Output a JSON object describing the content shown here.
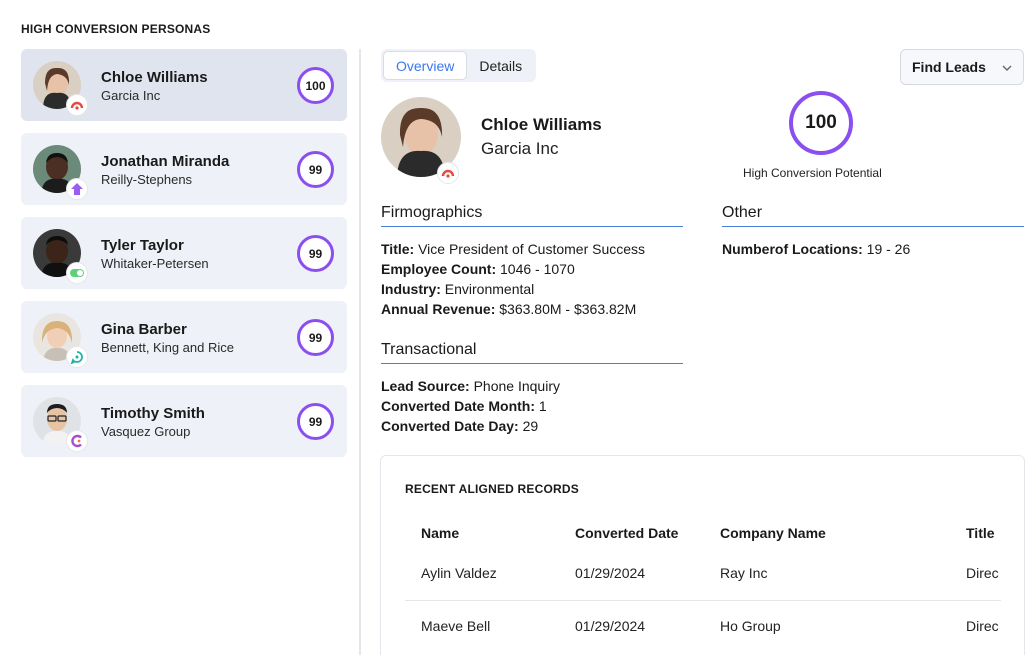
{
  "header": {
    "section_title": "HIGH CONVERSION PERSONAS"
  },
  "personas": [
    {
      "name": "Chloe Williams",
      "company": "Garcia Inc",
      "score": "100",
      "badge_icon": "crm-arc-icon",
      "selected": true
    },
    {
      "name": "Jonathan Miranda",
      "company": "Reilly-Stephens",
      "score": "99",
      "badge_icon": "purple-house-icon"
    },
    {
      "name": "Tyler Taylor",
      "company": "Whitaker-Petersen",
      "score": "99",
      "badge_icon": "green-toggle-icon"
    },
    {
      "name": "Gina Barber",
      "company": "Bennett, King and Rice",
      "score": "99",
      "badge_icon": "teal-chat-icon"
    },
    {
      "name": "Timothy Smith",
      "company": "Vasquez Group",
      "score": "99",
      "badge_icon": "purple-c-icon"
    }
  ],
  "tabs": [
    {
      "label": "Overview",
      "active": true
    },
    {
      "label": "Details"
    }
  ],
  "find_leads": {
    "label": "Find Leads"
  },
  "detail": {
    "name": "Chloe Williams",
    "company": "Garcia Inc",
    "score": "100",
    "score_label": "High Conversion Potential",
    "firmographics": {
      "heading": "Firmographics",
      "fields": [
        {
          "label": "Title:",
          "value": "Vice President of Customer Success"
        },
        {
          "label": "Employee Count:",
          "value": "1046 - 1070"
        },
        {
          "label": "Industry:",
          "value": "Environmental"
        },
        {
          "label": "Annual Revenue:",
          "value": "$363.80M - $363.82M"
        }
      ]
    },
    "other": {
      "heading": "Other",
      "fields": [
        {
          "label": "Numberof Locations:",
          "value": "19 - 26"
        }
      ]
    },
    "transactional": {
      "heading": "Transactional",
      "fields": [
        {
          "label": "Lead Source:",
          "value": "Phone Inquiry"
        },
        {
          "label": "Converted Date Month:",
          "value": "1"
        },
        {
          "label": "Converted Date Day:",
          "value": "29"
        }
      ]
    }
  },
  "records": {
    "title": "RECENT ALIGNED RECORDS",
    "columns": [
      "Name",
      "Converted Date",
      "Company Name",
      "Title"
    ],
    "rows": [
      [
        "Aylin Valdez",
        "01/29/2024",
        "Ray Inc",
        "Direc"
      ],
      [
        "Maeve Bell",
        "01/29/2024",
        "Ho Group",
        "Direc"
      ]
    ]
  },
  "colors": {
    "accent_purple": "#8b4ff0",
    "accent_blue": "#3a78f0",
    "card_bg": "#eef1f7",
    "selected_bg": "#dfe4ee"
  }
}
